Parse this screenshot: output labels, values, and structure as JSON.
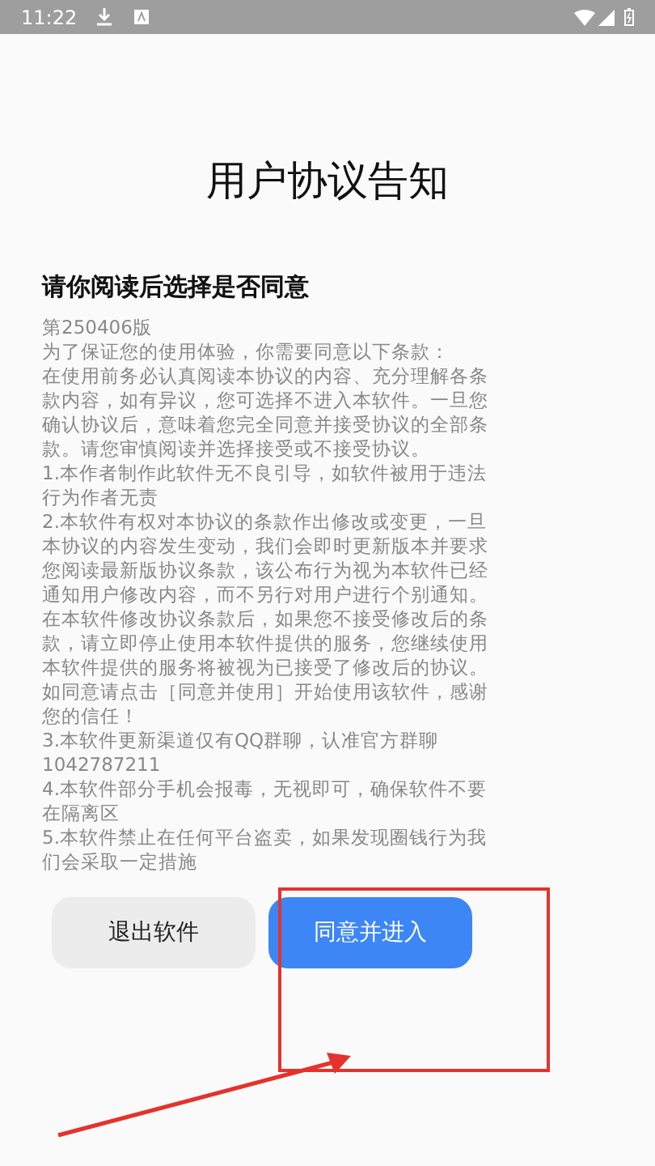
{
  "status_bar": {
    "time": "11:22"
  },
  "title": "用户协议告知",
  "subtitle": "请你阅读后选择是否同意",
  "agreement": [
    "第250406版",
    "为了保证您的使用体验，你需要同意以下条款：",
    "在使用前务必认真阅读本协议的内容、充分理解各条款内容，如有异议，您可选择不进入本软件。一旦您确认协议后，意味着您完全同意并接受协议的全部条款。请您审慎阅读并选择接受或不接受协议。",
    "1.本作者制作此软件无不良引导，如软件被用于违法行为作者无责",
    "2.本软件有权对本协议的条款作出修改或变更，一旦本协议的内容发生变动，我们会即时更新版本并要求您阅读最新版协议条款，该公布行为视为本软件已经通知用户修改内容，而不另行对用户进行个别通知。在本软件修改协议条款后，如果您不接受修改后的条款，请立即停止使用本软件提供的服务，您继续使用本软件提供的服务将被视为已接受了修改后的协议。如同意请点击［同意并使用］开始使用该软件，感谢您的信任！",
    "3.本软件更新渠道仅有QQ群聊，认准官方群聊1042787211",
    "4.本软件部分手机会报毒，无视即可，确保软件不要在隔离区",
    "5.本软件禁止在任何平台盗卖，如果发现圈钱行为我们会采取一定措施"
  ],
  "buttons": [
    {
      "label": "退出软件",
      "kind": "secondary"
    },
    {
      "label": "同意并进入",
      "kind": "primary"
    }
  ]
}
